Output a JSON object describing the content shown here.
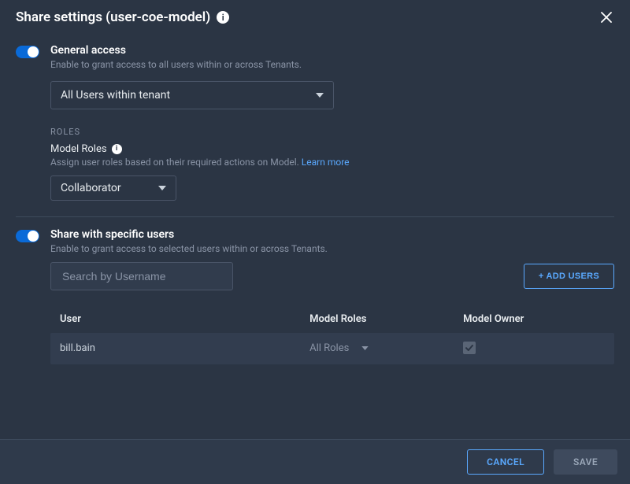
{
  "header": {
    "title": "Share settings (user-coe-model)"
  },
  "general": {
    "toggleOn": true,
    "title": "General access",
    "subtitle": "Enable to grant access to all users within or across Tenants.",
    "scopeSelect": {
      "value": "All Users within tenant"
    },
    "rolesHeading": "ROLES",
    "modelRolesLabel": "Model Roles",
    "modelRolesHelp": "Assign user roles based on their required actions on Model. ",
    "learnMore": "Learn more",
    "roleSelect": {
      "value": "Collaborator"
    }
  },
  "specific": {
    "toggleOn": true,
    "title": "Share with specific users",
    "subtitle": "Enable to grant access to selected users within or across Tenants.",
    "search": {
      "placeholder": "Search by Username",
      "value": ""
    },
    "addUsersLabel": "+ ADD USERS",
    "table": {
      "columns": {
        "user": "User",
        "roles": "Model Roles",
        "owner": "Model Owner"
      },
      "rows": [
        {
          "user": "bill.bain",
          "roles": "All Roles",
          "owner": true
        }
      ]
    }
  },
  "footer": {
    "cancel": "CANCEL",
    "save": "SAVE"
  }
}
